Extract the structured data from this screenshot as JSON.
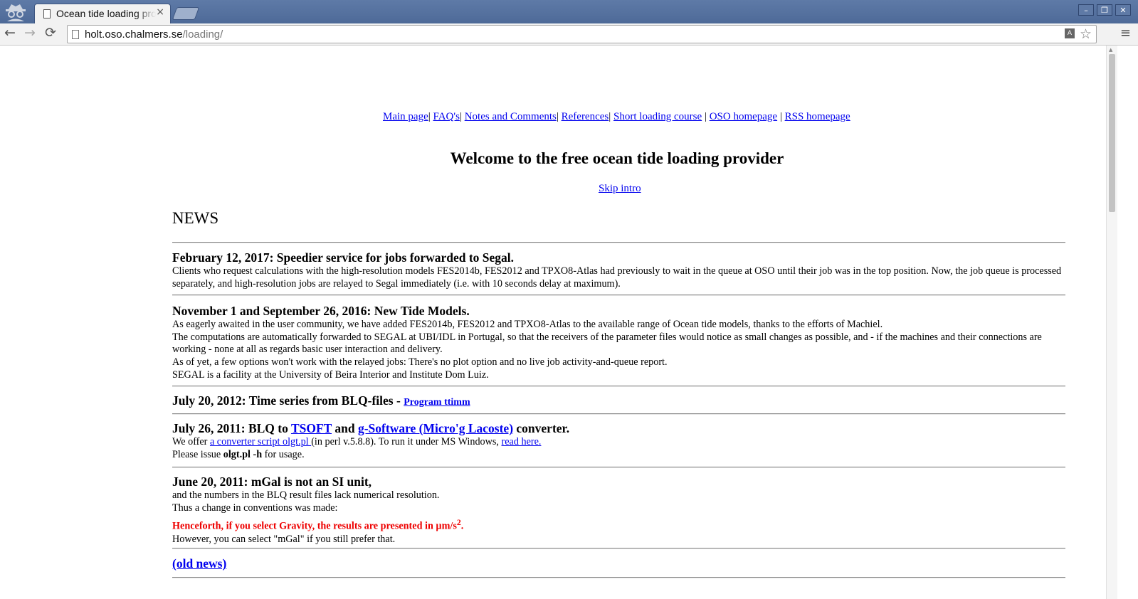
{
  "browser": {
    "tab_title": "Ocean tide loading provider",
    "tab_close": "×",
    "url_host": "holt.oso.chalmers.se",
    "url_path": "/loading/",
    "back": "←",
    "forward": "→",
    "reload": "⟳",
    "star": "☆",
    "menu": "≡",
    "win_min": "–",
    "win_max": "❐",
    "win_close": "✕"
  },
  "nav": [
    {
      "label": "Main page",
      "sep": "| "
    },
    {
      "label": "FAQ's",
      "sep": "| "
    },
    {
      "label": "Notes and Comments",
      "sep": "| "
    },
    {
      "label": "References",
      "sep": "| "
    },
    {
      "label": "Short loading course",
      "sep": " | "
    },
    {
      "label": "OSO homepage",
      "sep": " | "
    },
    {
      "label": "RSS homepage",
      "sep": ""
    }
  ],
  "welcome": "Welcome to the free ocean tide loading provider",
  "skip_intro": "Skip intro",
  "news_heading": "NEWS",
  "news": {
    "n1": {
      "title": "February 12, 2017: Speedier service for jobs forwarded to Segal.",
      "body": "Clients who request calculations with the high-resolution models FES2014b, FES2012 and TPXO8-Atlas had previously to wait in the queue at OSO until their job was in the top position. Now, the job queue is processed separately, and high-resolution jobs are relayed to Segal immediately (i.e. with 10 seconds delay at maximum)."
    },
    "n2": {
      "title": "November 1 and September 26, 2016: New Tide Models.",
      "line1": "As eagerly awaited in the user community, we have added FES2014b, FES2012 and TPXO8-Atlas to the available range of Ocean tide models, thanks to the efforts of Machiel.",
      "line2": "The computations are automatically forwarded to SEGAL at UBI/IDL in Portugal, so that the receivers of the parameter files would notice as small changes as possible, and - if the machines and their connections are working - none at all as regards basic user interaction and delivery.",
      "line3": "As of yet, a few options won't work with the relayed jobs: There's no plot option and no live job activity-and-queue report.",
      "line4": "SEGAL is a facility at the University of Beira Interior and Institute Dom Luiz."
    },
    "n3": {
      "title": "July 20, 2012: Time series from BLQ-files - ",
      "link": "Program ttimm"
    },
    "n4": {
      "title_a": "July 26, 2011: BLQ to ",
      "link_tsoft": "TSOFT",
      "title_b": " and ",
      "link_gsoft": "g-Software (Micro'g Lacoste)",
      "title_c": " converter.",
      "we_offer": "We offer ",
      "link_script": "a converter script olgt.pl ",
      "perl": "(in perl v.5.8.8). To run it under MS Windows, ",
      "link_read": "read here. ",
      "please": "Please issue ",
      "cmd": "olgt.pl -h",
      "usage": " for usage."
    },
    "n5": {
      "title": "June 20, 2011: mGal is not an SI unit,",
      "line1": "and the numbers in the BLQ result files lack numerical resolution.",
      "line2": "Thus a change in conventions was made:",
      "red": "Henceforth, if you select Gravity, the results are presented in µm/s",
      "red_sup": "2",
      "red_end": ".",
      "line3": "However, you can select \"mGal\" if you still prefer that."
    },
    "old_news": "(old news)"
  }
}
